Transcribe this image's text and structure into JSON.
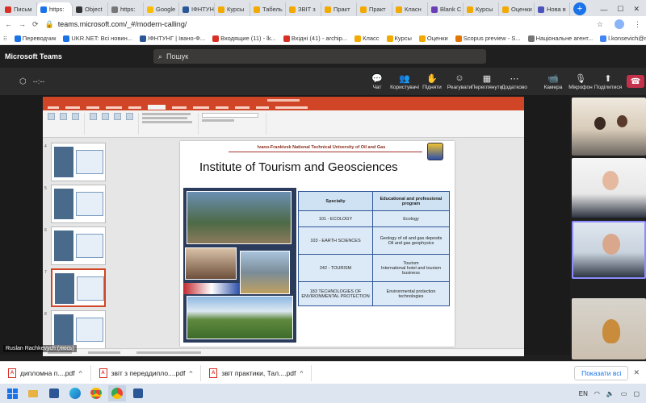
{
  "browser": {
    "tabs": [
      {
        "label": "Письм",
        "color": "#d93025"
      },
      {
        "label": "https:",
        "color": "#1a73e8"
      },
      {
        "label": "Object",
        "color": "#333333"
      },
      {
        "label": "https:",
        "color": "#777777"
      },
      {
        "label": "Google",
        "color": "#fbbc04"
      },
      {
        "label": "ІФНТУН",
        "color": "#2b5797"
      },
      {
        "label": "Курсы",
        "color": "#f2a900"
      },
      {
        "label": "Табель",
        "color": "#f2a900"
      },
      {
        "label": "ЗВІТ з",
        "color": "#f2a900"
      },
      {
        "label": "Практ",
        "color": "#f2a900"
      },
      {
        "label": "Практ",
        "color": "#f2a900"
      },
      {
        "label": "Класн",
        "color": "#f2a900"
      },
      {
        "label": "Blank C",
        "color": "#6a3fb5"
      },
      {
        "label": "Курсы",
        "color": "#f2a900"
      },
      {
        "label": "Оценки",
        "color": "#f2a900"
      },
      {
        "label": "Нова в",
        "color": "#4b53bc"
      }
    ],
    "new_tab": "+",
    "url": "teams.microsoft.com/_#/modern-calling/",
    "bookmarks": [
      {
        "label": "Переводчик",
        "color": "#1a73e8"
      },
      {
        "label": "UKR.NET: Всі новин...",
        "color": "#1a73e8"
      },
      {
        "label": "ІФНТУНГ | Івано-Ф...",
        "color": "#2b5797"
      },
      {
        "label": "Входящие (11) - lk...",
        "color": "#d93025"
      },
      {
        "label": "Вхідні (41) - archip...",
        "color": "#d93025"
      },
      {
        "label": "Класс",
        "color": "#f2a900"
      },
      {
        "label": "Курсы",
        "color": "#f2a900"
      },
      {
        "label": "Оценки",
        "color": "#f2a900"
      },
      {
        "label": "Scopus preview - S...",
        "color": "#e37400"
      },
      {
        "label": "Національне агент...",
        "color": "#777777"
      },
      {
        "label": "l.konsevich@nung.e...",
        "color": "#4285f4"
      }
    ]
  },
  "teams": {
    "app_title": "Microsoft Teams",
    "search_placeholder": "Пошук",
    "timer": "--:--",
    "toolbar": [
      {
        "label": "Чат",
        "icon": "chat-icon",
        "glyph": "💬"
      },
      {
        "label": "Користувачі",
        "icon": "people-icon",
        "glyph": "👥"
      },
      {
        "label": "Підняти",
        "icon": "raise-hand-icon",
        "glyph": "✋"
      },
      {
        "label": "Реагувати",
        "icon": "react-icon",
        "glyph": "☺"
      },
      {
        "label": "Переглянути",
        "icon": "view-icon",
        "glyph": "▦"
      },
      {
        "label": "Додатково",
        "icon": "more-icon",
        "glyph": "⋯"
      },
      {
        "label": "Камера",
        "icon": "camera-icon",
        "glyph": "📹"
      },
      {
        "label": "Мікрофон",
        "icon": "mic-icon",
        "glyph": "🎙"
      },
      {
        "label": "Поділитися",
        "icon": "share-icon",
        "glyph": "⬆"
      }
    ],
    "presenter": "Ruslan Rachkevych (люсь)"
  },
  "slide": {
    "university": "Ivano-Frankivsk National Technical University of Oil and Gas",
    "title": "Institute of Tourism and Geosciences",
    "table": {
      "headers": [
        "Specialty",
        "Educational and professional program"
      ],
      "rows": [
        {
          "specialty": "101 - ECOLOGY",
          "program": "Ecology"
        },
        {
          "specialty": "103 - EARTH SCIENCES",
          "program": "Geology of oil and gas deposits\nOil and gas geophysics"
        },
        {
          "specialty": "242 - TOURISM",
          "program": "Tourism\nInternational hotel and tourism business"
        },
        {
          "specialty": "183 TECHNOLOGIES OF ENVIRONMENTAL PROTECTION",
          "program": "Environmental protection technologies"
        }
      ]
    }
  },
  "ppt": {
    "thumb_numbers": [
      "4",
      "5",
      "6",
      "7",
      "8"
    ],
    "selected_thumb": "7"
  },
  "downloads": {
    "items": [
      "дипломна п....pdf",
      "звіт з переддипло....pdf",
      "звіт практики, Тал....pdf"
    ],
    "show_all": "Показати всі"
  },
  "taskbar": {
    "lang": "EN"
  }
}
